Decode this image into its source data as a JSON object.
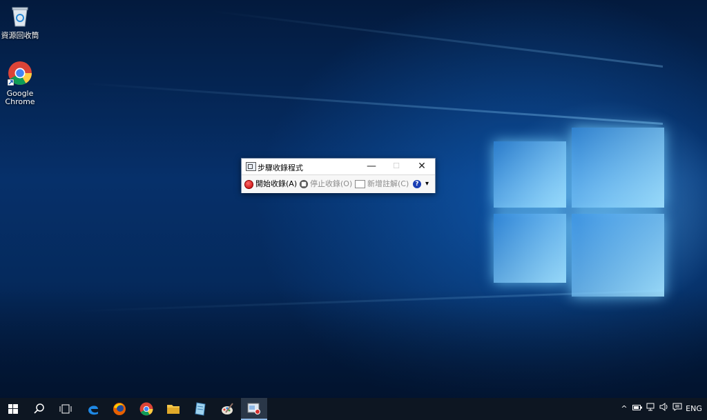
{
  "desktop": {
    "icons": [
      {
        "label": "資源回收筒",
        "icon": "recycle-bin-icon"
      },
      {
        "label_line1": "Google",
        "label_line2": "Chrome",
        "icon": "chrome-icon"
      }
    ]
  },
  "window": {
    "title": "步驟收錄程式",
    "controls": {
      "minimize": "—",
      "maximize": "☐",
      "close": "✕"
    },
    "toolbar": {
      "start": "開始收錄(A)",
      "stop": "停止收錄(O)",
      "comment": "新增註解(C)",
      "help": "?",
      "dropdown": "▾"
    }
  },
  "taskbar": {
    "items": [
      "start-icon",
      "search-icon",
      "task-view-icon",
      "edge-icon",
      "firefox-icon",
      "chrome-icon",
      "file-explorer-icon",
      "notepad-icon",
      "paint-icon",
      "steps-recorder-icon"
    ],
    "active": "steps-recorder-icon",
    "tray": {
      "chevron": "^",
      "language": "ENG"
    }
  },
  "colors": {
    "accent": "#1a3fb5",
    "record": "#c10000",
    "taskbar": "#0d1622"
  }
}
